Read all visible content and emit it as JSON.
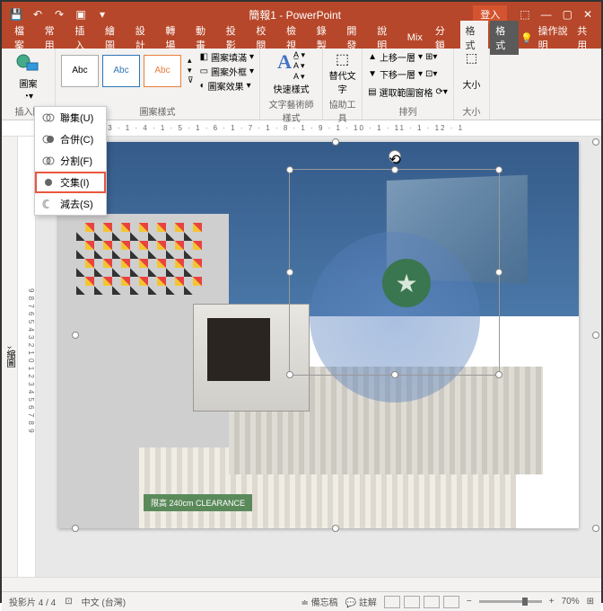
{
  "titlebar": {
    "doc_title": "簡報1 - PowerPoint",
    "login": "登入"
  },
  "tabs": [
    "檔案",
    "常用",
    "插入",
    "繪圖",
    "設計",
    "轉場",
    "動畫",
    "投影",
    "校閱",
    "檢視",
    "錄製",
    "開發",
    "說明",
    "Mix",
    "分鎖",
    "格式",
    "格式"
  ],
  "tell_me": "操作說明",
  "share": "共用",
  "groups": {
    "insert": "插入圖",
    "shape_styles": "圖案樣式",
    "wordart": "文字藝術師樣式",
    "alt": "協助工具",
    "arrange": "排列",
    "size": "大小"
  },
  "style_abc": "Abc",
  "shape_fill": "圖案填滿",
  "shape_outline": "圖案外框",
  "shape_effects": "圖案效果",
  "quick_style": "快速樣式",
  "alt_text": "替代文字",
  "bring_forward": "上移一層",
  "send_backward": "下移一層",
  "selection_pane": "選取範圍窗格",
  "size_label": "大小",
  "merge_menu": {
    "union": "聯集(U)",
    "combine": "合併(C)",
    "fragment": "分割(F)",
    "intersect": "交集(I)",
    "subtract": "減去(S)"
  },
  "side_label": "縮圖",
  "clearance_text": "限高 240cm CLEARANCE",
  "status": {
    "slide": "投影片 4 / 4",
    "lang": "中文 (台灣)",
    "notes": "備忘稿",
    "comments": "註解",
    "zoom": "70%"
  },
  "ruler_marks": "1 · 1 · 2 · 1 · 3 · 1 · 4 · 1 · 5 · 1 · 6 · 1 · 7 · 1 · 8 · 1 · 9 · 1 · 10 · 1 · 11 · 1 · 12 · 1"
}
